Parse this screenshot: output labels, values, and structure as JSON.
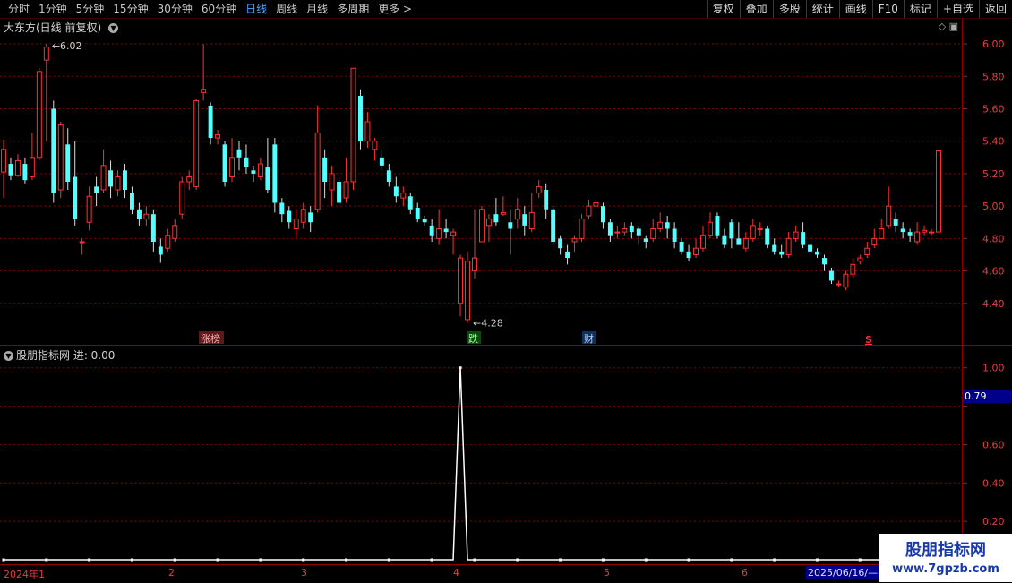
{
  "toolbar": {
    "periods": [
      "分时",
      "1分钟",
      "5分钟",
      "15分钟",
      "30分钟",
      "60分钟",
      "日线",
      "周线",
      "月线",
      "多周期",
      "更多 >"
    ],
    "active_period": "日线",
    "right_buttons": [
      "复权",
      "叠加",
      "多股",
      "统计",
      "画线",
      "F10",
      "标记",
      "+自选",
      "返回"
    ]
  },
  "main": {
    "title": "大东方(日线 前复权)",
    "max_label": "6.02",
    "min_label": "4.28",
    "y_ticks": [
      "6.00",
      "5.80",
      "5.60",
      "5.40",
      "5.20",
      "5.00",
      "4.80",
      "4.60",
      "4.40"
    ],
    "markers": {
      "zhangbang": "涨榜",
      "die": "跌",
      "cai": "财",
      "s": "S"
    }
  },
  "indicator": {
    "title": "股朋指标网 进: 0.00",
    "y_ticks": [
      "1.00",
      "0.60",
      "0.40",
      "0.20"
    ],
    "cursor_value": "0.79"
  },
  "dates": {
    "labels": [
      "2024年1",
      "2",
      "3",
      "4",
      "5",
      "6"
    ],
    "current": "2025/06/16/—"
  },
  "watermark": {
    "line1": "股朋指标网",
    "line2": "www.7gpzb.com"
  },
  "colors": {
    "up": "#ff3232",
    "down": "#54ffff",
    "grid": "#8b0000",
    "bg": "#000000"
  },
  "chart_data": {
    "type": "candlestick",
    "ylim": [
      4.2,
      6.05
    ],
    "candles": [
      [
        5.21,
        5.35,
        5.41,
        5.05
      ],
      [
        5.26,
        5.19,
        5.3,
        5.16
      ],
      [
        5.19,
        5.28,
        5.32,
        5.18
      ],
      [
        5.26,
        5.16,
        5.3,
        5.14
      ],
      [
        5.18,
        5.3,
        5.45,
        5.16
      ],
      [
        5.3,
        5.83,
        5.85,
        5.28
      ],
      [
        5.9,
        5.98,
        6.0,
        5.4
      ],
      [
        5.6,
        5.08,
        5.65,
        5.02
      ],
      [
        5.1,
        5.5,
        5.52,
        5.05
      ],
      [
        5.38,
        5.15,
        5.48,
        5.1
      ],
      [
        5.18,
        4.92,
        5.4,
        4.88
      ],
      [
        4.78,
        4.78,
        4.8,
        4.7
      ],
      [
        4.9,
        5.06,
        5.12,
        4.85
      ],
      [
        5.12,
        5.08,
        5.18,
        5.0
      ],
      [
        5.1,
        5.25,
        5.35,
        5.08
      ],
      [
        5.22,
        5.12,
        5.28,
        5.05
      ],
      [
        5.1,
        5.18,
        5.22,
        5.06
      ],
      [
        5.22,
        5.1,
        5.26,
        5.05
      ],
      [
        5.08,
        4.98,
        5.12,
        4.95
      ],
      [
        4.98,
        4.92,
        5.02,
        4.88
      ],
      [
        4.92,
        4.95,
        5.0,
        4.88
      ],
      [
        4.95,
        4.78,
        4.98,
        4.72
      ],
      [
        4.75,
        4.7,
        4.8,
        4.65
      ],
      [
        4.74,
        4.82,
        4.86,
        4.72
      ],
      [
        4.8,
        4.88,
        4.92,
        4.78
      ],
      [
        4.95,
        5.15,
        5.18,
        4.92
      ],
      [
        5.15,
        5.18,
        5.22,
        5.1
      ],
      [
        5.12,
        5.65,
        5.66,
        5.1
      ],
      [
        5.7,
        5.72,
        6.0,
        5.65
      ],
      [
        5.62,
        5.42,
        5.64,
        5.38
      ],
      [
        5.42,
        5.44,
        5.47,
        5.38
      ],
      [
        5.38,
        5.15,
        5.4,
        5.12
      ],
      [
        5.18,
        5.3,
        5.42,
        5.15
      ],
      [
        5.35,
        5.3,
        5.4,
        5.22
      ],
      [
        5.3,
        5.24,
        5.38,
        5.2
      ],
      [
        5.22,
        5.2,
        5.25,
        5.15
      ],
      [
        5.18,
        5.26,
        5.3,
        5.16
      ],
      [
        5.24,
        5.1,
        5.42,
        5.08
      ],
      [
        5.38,
        5.02,
        5.42,
        4.96
      ],
      [
        5.02,
        4.95,
        5.05,
        4.9
      ],
      [
        4.97,
        4.9,
        5.0,
        4.86
      ],
      [
        4.86,
        4.92,
        4.98,
        4.8
      ],
      [
        4.9,
        4.98,
        5.02,
        4.86
      ],
      [
        4.96,
        4.9,
        5.0,
        4.84
      ],
      [
        4.98,
        5.45,
        5.62,
        4.96
      ],
      [
        5.3,
        5.15,
        5.35,
        5.05
      ],
      [
        5.1,
        5.2,
        5.25,
        5.0
      ],
      [
        5.15,
        5.02,
        5.18,
        5.0
      ],
      [
        5.05,
        5.15,
        5.3,
        5.02
      ],
      [
        5.15,
        5.85,
        5.85,
        5.1
      ],
      [
        5.68,
        5.4,
        5.72,
        5.35
      ],
      [
        5.4,
        5.52,
        5.58,
        5.36
      ],
      [
        5.35,
        5.4,
        5.42,
        5.28
      ],
      [
        5.3,
        5.25,
        5.35,
        5.22
      ],
      [
        5.22,
        5.15,
        5.26,
        5.12
      ],
      [
        5.12,
        5.06,
        5.18,
        5.02
      ],
      [
        5.05,
        5.08,
        5.12,
        5.0
      ],
      [
        5.06,
        4.98,
        5.08,
        4.95
      ],
      [
        4.99,
        4.92,
        5.02,
        4.9
      ],
      [
        4.92,
        4.9,
        4.94,
        4.88
      ],
      [
        4.88,
        4.82,
        4.92,
        4.78
      ],
      [
        4.8,
        4.86,
        4.98,
        4.76
      ],
      [
        4.86,
        4.84,
        4.92,
        4.8
      ],
      [
        4.82,
        4.84,
        4.86,
        4.7
      ],
      [
        4.4,
        4.68,
        4.7,
        4.32
      ],
      [
        4.3,
        4.66,
        4.72,
        4.28
      ],
      [
        4.6,
        4.68,
        4.98,
        4.55
      ],
      [
        4.78,
        4.98,
        5.0,
        4.78
      ],
      [
        4.88,
        4.92,
        4.95,
        4.78
      ],
      [
        4.95,
        4.9,
        5.05,
        4.88
      ],
      [
        4.95,
        4.96,
        5.06,
        4.94
      ],
      [
        4.9,
        4.86,
        4.98,
        4.7
      ],
      [
        4.92,
        4.98,
        5.05,
        4.86
      ],
      [
        4.95,
        4.88,
        5.0,
        4.82
      ],
      [
        4.86,
        4.96,
        5.08,
        4.84
      ],
      [
        5.08,
        5.12,
        5.16,
        5.05
      ],
      [
        5.1,
        4.98,
        5.14,
        4.92
      ],
      [
        4.98,
        4.78,
        5.0,
        4.76
      ],
      [
        4.8,
        4.74,
        4.82,
        4.7
      ],
      [
        4.72,
        4.68,
        4.76,
        4.64
      ],
      [
        4.78,
        4.8,
        4.82,
        4.72
      ],
      [
        4.8,
        4.92,
        4.95,
        4.78
      ],
      [
        4.94,
        5.0,
        5.04,
        4.92
      ],
      [
        5.0,
        5.02,
        5.06,
        4.86
      ],
      [
        5.0,
        4.9,
        5.02,
        4.86
      ],
      [
        4.9,
        4.82,
        4.92,
        4.78
      ],
      [
        4.84,
        4.84,
        4.88,
        4.8
      ],
      [
        4.84,
        4.86,
        4.9,
        4.82
      ],
      [
        4.88,
        4.84,
        4.9,
        4.8
      ],
      [
        4.86,
        4.82,
        4.88,
        4.76
      ],
      [
        4.8,
        4.78,
        4.82,
        4.74
      ],
      [
        4.8,
        4.86,
        4.92,
        4.78
      ],
      [
        4.86,
        4.9,
        4.96,
        4.84
      ],
      [
        4.9,
        4.86,
        4.94,
        4.8
      ],
      [
        4.86,
        4.78,
        4.9,
        4.74
      ],
      [
        4.78,
        4.72,
        4.8,
        4.7
      ],
      [
        4.72,
        4.68,
        4.76,
        4.66
      ],
      [
        4.7,
        4.74,
        4.8,
        4.68
      ],
      [
        4.74,
        4.82,
        4.88,
        4.72
      ],
      [
        4.82,
        4.9,
        4.96,
        4.8
      ],
      [
        4.94,
        4.82,
        4.96,
        4.8
      ],
      [
        4.82,
        4.76,
        4.86,
        4.74
      ],
      [
        4.9,
        4.8,
        4.92,
        4.74
      ],
      [
        4.8,
        4.76,
        4.9,
        4.76
      ],
      [
        4.74,
        4.8,
        4.84,
        4.72
      ],
      [
        4.8,
        4.88,
        4.92,
        4.78
      ],
      [
        4.86,
        4.86,
        4.9,
        4.82
      ],
      [
        4.86,
        4.76,
        4.88,
        4.74
      ],
      [
        4.76,
        4.72,
        4.8,
        4.7
      ],
      [
        4.72,
        4.7,
        4.76,
        4.68
      ],
      [
        4.7,
        4.8,
        4.84,
        4.68
      ],
      [
        4.8,
        4.84,
        4.88,
        4.78
      ],
      [
        4.84,
        4.76,
        4.9,
        4.74
      ],
      [
        4.76,
        4.72,
        4.78,
        4.68
      ],
      [
        4.72,
        4.7,
        4.74,
        4.68
      ],
      [
        4.68,
        4.64,
        4.7,
        4.6
      ],
      [
        4.6,
        4.54,
        4.62,
        4.52
      ],
      [
        4.52,
        4.52,
        4.54,
        4.5
      ],
      [
        4.5,
        4.58,
        4.6,
        4.48
      ],
      [
        4.58,
        4.64,
        4.68,
        4.56
      ],
      [
        4.66,
        4.68,
        4.7,
        4.64
      ],
      [
        4.7,
        4.74,
        4.78,
        4.68
      ],
      [
        4.76,
        4.8,
        4.86,
        4.74
      ],
      [
        4.8,
        4.86,
        4.92,
        4.8
      ],
      [
        4.88,
        5.0,
        5.12,
        4.86
      ],
      [
        4.92,
        4.88,
        4.96,
        4.84
      ],
      [
        4.86,
        4.84,
        4.9,
        4.8
      ],
      [
        4.84,
        4.82,
        4.86,
        4.78
      ],
      [
        4.78,
        4.84,
        4.9,
        4.76
      ],
      [
        4.84,
        4.85,
        4.88,
        4.82
      ],
      [
        4.84,
        4.84,
        4.86,
        4.82
      ],
      [
        4.84,
        5.34,
        5.34,
        4.84
      ]
    ],
    "indicator": {
      "type": "line",
      "ylim": [
        0,
        1.05
      ],
      "spike_index": 64,
      "values_note": "0 everywhere except 1.00 at spike_index"
    }
  }
}
